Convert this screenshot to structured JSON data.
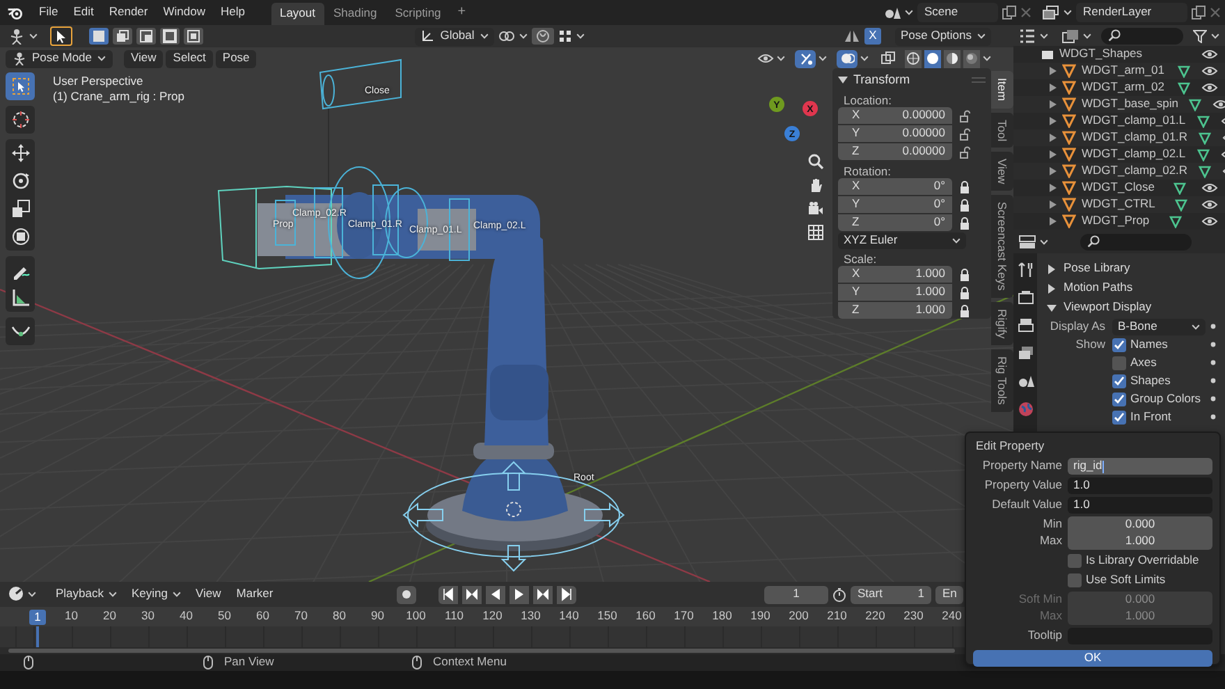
{
  "top_bar": {
    "menus": [
      "File",
      "Edit",
      "Render",
      "Window",
      "Help"
    ],
    "workspaces": [
      {
        "label": "Layout",
        "selected": true
      },
      {
        "label": "Shading",
        "selected": false
      },
      {
        "label": "Scripting",
        "selected": false
      }
    ],
    "add_workspace": "+",
    "scene": "Scene",
    "view_layer": "RenderLayer"
  },
  "tool_header": {
    "selection_modes": [
      {
        "selected": true
      },
      {
        "selected": false
      },
      {
        "selected": false
      },
      {
        "selected": false
      },
      {
        "selected": false
      }
    ],
    "orientation": "Global",
    "mirror_x": {
      "label": "X",
      "on": true
    },
    "pose_options": "Pose Options"
  },
  "viewport_header": {
    "mode": "Pose Mode",
    "menus": [
      "View",
      "Select",
      "Pose"
    ],
    "shading_modes": [
      {
        "selected": false
      },
      {
        "selected": true
      },
      {
        "selected": false
      },
      {
        "selected": false
      }
    ]
  },
  "toolbar": [
    {
      "kind": "select",
      "selected": true
    },
    {
      "kind": "cursor",
      "selected": false
    },
    {
      "kind": "move",
      "selected": false
    },
    {
      "kind": "rotate",
      "selected": false
    },
    {
      "kind": "scale",
      "selected": false
    },
    {
      "kind": "transform",
      "selected": false
    },
    {
      "kind": "annotate",
      "selected": false
    },
    {
      "kind": "measure",
      "selected": false
    },
    {
      "kind": "relax",
      "selected": false
    }
  ],
  "viewport": {
    "view_name": "User Perspective",
    "object_info": "(1) Crane_arm_rig : Prop",
    "bone_labels": [
      "Close",
      "Prop",
      "Clamp_02.R",
      "Clamp_01.R",
      "Clamp_01.L",
      "Clamp_02.L",
      "Root"
    ],
    "gizmo": [
      {
        "label": "Y",
        "color": "#6f9a1f"
      },
      {
        "label": "X",
        "color": "#e0364e"
      },
      {
        "label": "Z",
        "color": "#3a7fd6"
      }
    ]
  },
  "sidebar": {
    "panel": {
      "title": "Transform",
      "expanded": true,
      "groups": [
        {
          "kind": "vector",
          "label": "Location:",
          "rows": [
            {
              "axis": "X",
              "value": "0.00000",
              "locked": false
            },
            {
              "axis": "Y",
              "value": "0.00000",
              "locked": false
            },
            {
              "axis": "Z",
              "value": "0.00000",
              "locked": false
            }
          ]
        },
        {
          "kind": "vector",
          "label": "Rotation:",
          "rows": [
            {
              "axis": "X",
              "value": "0°",
              "locked": true
            },
            {
              "axis": "Y",
              "value": "0°",
              "locked": true
            },
            {
              "axis": "Z",
              "value": "0°",
              "locked": true
            }
          ]
        },
        {
          "kind": "dropdown",
          "value": "XYZ Euler"
        },
        {
          "kind": "vector",
          "label": "Scale:",
          "rows": [
            {
              "axis": "X",
              "value": "1.000",
              "locked": true
            },
            {
              "axis": "Y",
              "value": "1.000",
              "locked": true
            },
            {
              "axis": "Z",
              "value": "1.000",
              "locked": true
            }
          ]
        }
      ]
    },
    "tabs": [
      {
        "label": "Item",
        "selected": true
      },
      {
        "label": "Tool",
        "selected": false
      },
      {
        "label": "View",
        "selected": false
      },
      {
        "label": "Screencast Keys",
        "selected": false
      },
      {
        "label": "Rigify",
        "selected": false
      },
      {
        "label": "Rig Tools",
        "selected": false
      }
    ]
  },
  "outliner": {
    "collection": {
      "label": "WDGT_Shapes",
      "children": [
        {
          "label": "WDGT_arm_01"
        },
        {
          "label": "WDGT_arm_02"
        },
        {
          "label": "WDGT_base_spin"
        },
        {
          "label": "WDGT_clamp_01.L"
        },
        {
          "label": "WDGT_clamp_01.R"
        },
        {
          "label": "WDGT_clamp_02.L"
        },
        {
          "label": "WDGT_clamp_02.R"
        },
        {
          "label": "WDGT_Close"
        },
        {
          "label": "WDGT_CTRL"
        },
        {
          "label": "WDGT_Prop"
        }
      ]
    }
  },
  "properties": {
    "sections": [
      {
        "title": "Pose Library",
        "expanded": false
      },
      {
        "title": "Motion Paths",
        "expanded": false
      },
      {
        "title": "Viewport Display",
        "expanded": true,
        "rows": [
          {
            "kind": "dropdown",
            "label": "Display As",
            "value": "B-Bone"
          },
          {
            "kind": "checkbox",
            "label": "Show",
            "text": "Names",
            "checked": true
          },
          {
            "kind": "checkbox",
            "text": "Axes",
            "checked": false
          },
          {
            "kind": "checkbox",
            "text": "Shapes",
            "checked": true
          },
          {
            "kind": "checkbox",
            "text": "Group Colors",
            "checked": true
          },
          {
            "kind": "checkbox",
            "text": "In Front",
            "checked": true
          }
        ]
      }
    ]
  },
  "timeline": {
    "menus": [
      "Playback",
      "Keying",
      "View",
      "Marker"
    ],
    "current_frame": "1",
    "start_label": "Start",
    "start": "1",
    "end_label": "En",
    "playhead": "1",
    "ticks": [
      "10",
      "20",
      "30",
      "40",
      "50",
      "60",
      "70",
      "80",
      "90",
      "100",
      "110",
      "120",
      "130",
      "140",
      "150",
      "160",
      "170",
      "180",
      "190",
      "200",
      "210",
      "220",
      "230",
      "240"
    ]
  },
  "status_bar": [
    "Pan View",
    "Context Menu"
  ],
  "dialog": {
    "title": "Edit Property",
    "fields": [
      {
        "kind": "text",
        "label": "Property Name",
        "value": "rig_id",
        "active": true
      },
      {
        "kind": "text",
        "label": "Property Value",
        "value": "1.0",
        "active": false
      },
      {
        "kind": "text",
        "label": "Default Value",
        "value": "1.0",
        "active": false
      },
      {
        "kind": "number",
        "label": "Min",
        "value": "0.000",
        "disabled": false
      },
      {
        "kind": "number",
        "label": "Max",
        "value": "1.000",
        "disabled": false
      },
      {
        "kind": "checkbox",
        "label": "Is Library Overridable",
        "checked": false
      },
      {
        "kind": "checkbox",
        "label": "Use Soft Limits",
        "checked": false
      },
      {
        "kind": "number",
        "label": "Soft Min",
        "value": "0.000",
        "disabled": true
      },
      {
        "kind": "number",
        "label": "Max",
        "value": "1.000",
        "disabled": true
      },
      {
        "kind": "text",
        "label": "Tooltip",
        "active": false
      }
    ],
    "ok": "OK"
  }
}
